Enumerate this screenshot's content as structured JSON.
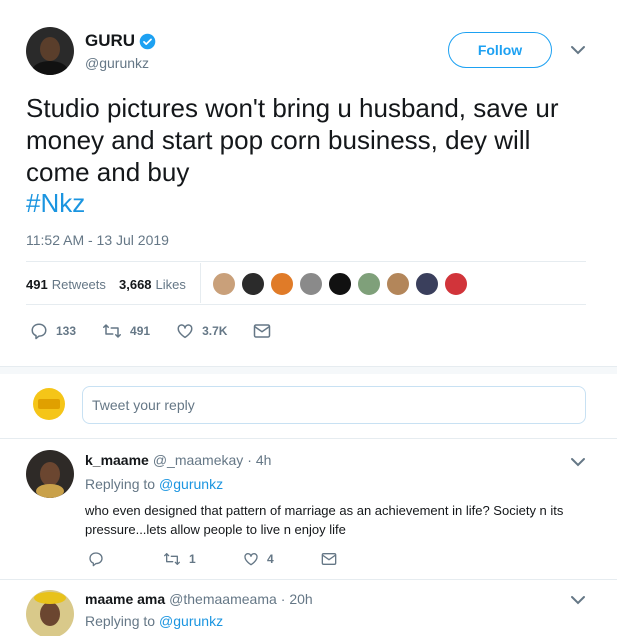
{
  "tweet": {
    "author_name": "GURU",
    "author_handle": "@gurunkz",
    "follow_label": "Follow",
    "text": "Studio pictures won't bring u husband, save ur money and start pop corn business, dey will come and buy",
    "hashtag": "#Nkz",
    "timestamp": "11:52 AM - 13 Jul 2019",
    "retweets_count": "491",
    "retweets_label": "Retweets",
    "likes_count": "3,668",
    "likes_label": "Likes",
    "actions": {
      "replies": "133",
      "retweets": "491",
      "likes": "3.7K"
    }
  },
  "reply_box": {
    "placeholder": "Tweet your reply"
  },
  "replies": [
    {
      "name": "k_maame",
      "handle": "@_maamekay",
      "time": "· 4h",
      "replying_prefix": "Replying to",
      "replying_to": "@gurunkz",
      "text": "who even designed that pattern of marriage as an achievement in life? Society n its pressure...lets allow people to live n enjoy life",
      "retweets": "1",
      "likes": "4"
    },
    {
      "name": "maame ama",
      "handle": "@themaameama",
      "time": "· 20h",
      "replying_prefix": "Replying to",
      "replying_to": "@gurunkz"
    }
  ],
  "colors": {
    "accent": "#1da1f2",
    "link": "#1b95e0",
    "muted": "#657786",
    "divider": "#e6ecf0"
  },
  "icons": [
    "verified-badge-icon",
    "chevron-down-icon",
    "reply-icon",
    "retweet-icon",
    "like-icon",
    "message-icon"
  ]
}
